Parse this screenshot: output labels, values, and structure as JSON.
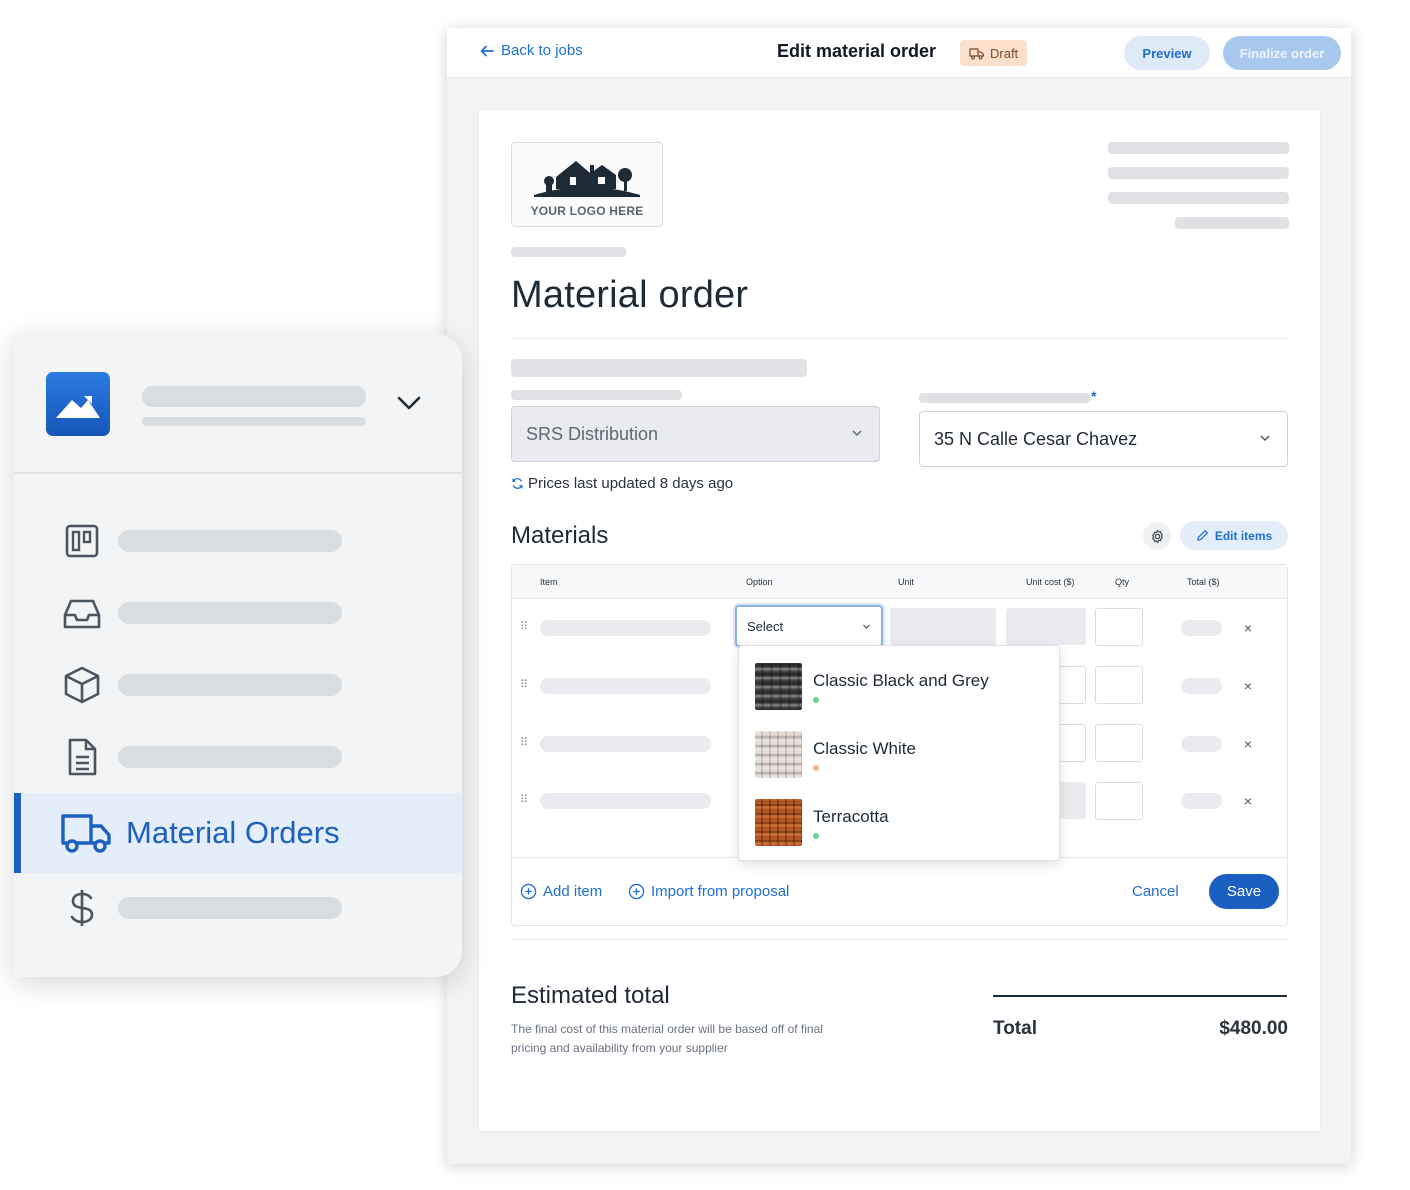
{
  "topbar": {
    "back_label": "Back to jobs",
    "title": "Edit material order",
    "status_badge": "Draft",
    "preview_label": "Preview",
    "finalize_label": "Finalize order"
  },
  "document": {
    "logo_text": "YOUR LOGO HERE",
    "title": "Material order",
    "supplier_value": "SRS Distribution",
    "address_value": "35 N Calle Cesar Chavez",
    "required_mark": "*",
    "prices_note": "Prices last updated 8 days ago"
  },
  "materials": {
    "title": "Materials",
    "edit_items_label": "Edit items",
    "columns": [
      "Item",
      "Option",
      "Unit",
      "Unit cost ($)",
      "Qty",
      "Total ($)"
    ],
    "option_select_value": "Select",
    "options": [
      {
        "label": "Classic Black and Grey",
        "status_color": "#6ccf8e"
      },
      {
        "label": "Classic White",
        "status_color": "#f5b98a"
      },
      {
        "label": "Terracotta",
        "status_color": "#6ccf8e"
      }
    ],
    "remove_symbol": "×",
    "add_item_label": "Add item",
    "import_label": "Import from proposal",
    "cancel_label": "Cancel",
    "save_label": "Save"
  },
  "estimate": {
    "title": "Estimated total",
    "description": "The final cost of this material order will be based off of final pricing and availability from your supplier",
    "total_label": "Total",
    "total_value": "$480.00"
  },
  "sidebar": {
    "active_label": "Material Orders",
    "icons": [
      "board-icon",
      "inbox-icon",
      "box-icon",
      "document-icon",
      "truck-icon",
      "dollar-icon"
    ]
  },
  "colors": {
    "accent": "#1b5fc1",
    "link": "#1f6fd1",
    "draft_badge_bg": "#fbe0cc"
  }
}
